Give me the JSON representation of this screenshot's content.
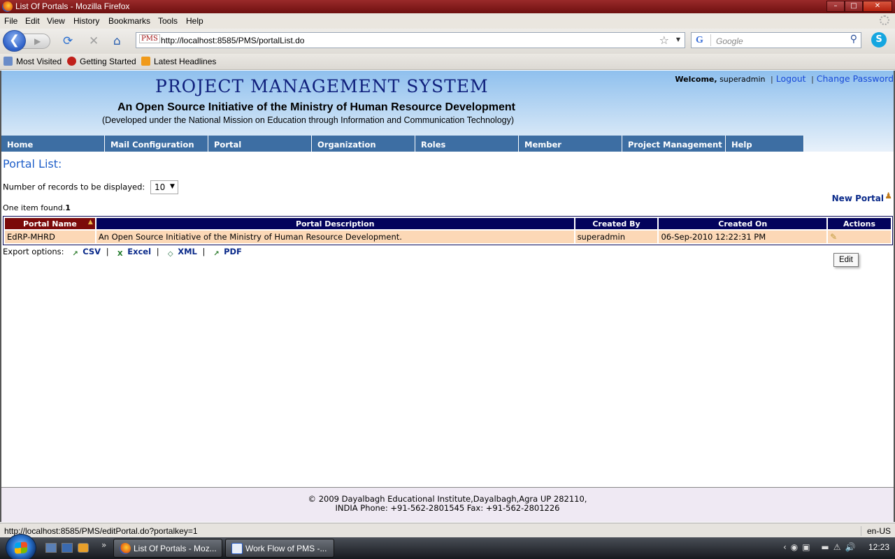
{
  "window": {
    "title": "List Of Portals - Mozilla Firefox",
    "buttons": [
      "–",
      "□",
      "✕"
    ]
  },
  "menubar": [
    "File",
    "Edit",
    "View",
    "History",
    "Bookmarks",
    "Tools",
    "Help"
  ],
  "navbar": {
    "url": "http://localhost:8585/PMS/portalList.do",
    "site_icon": "PMS",
    "search_placeholder": "Google",
    "search_engine_glyph": "G"
  },
  "bookmarks": [
    "Most Visited",
    "Getting Started",
    "Latest Headlines"
  ],
  "header": {
    "title": "PROJECT MANAGEMENT SYSTEM",
    "subtitle": "An Open Source Initiative of the Ministry of Human Resource Development",
    "subtitle2": "(Developed under the National Mission on Education through Information and Communication Technology)",
    "welcome_label": "Welcome,",
    "user": "superadmin",
    "sep": "|",
    "logout": "Logout",
    "change_password": "Change Password"
  },
  "mainnav": [
    "Home",
    "Mail Configuration",
    "Portal",
    "Organization",
    "Roles",
    "Member",
    "Project Management",
    "Help"
  ],
  "content": {
    "list_title": "Portal List:",
    "records_label": "Number of records to be displayed:",
    "records_value": "10",
    "new_portal": "New Portal",
    "found_text": "One item found.",
    "found_page": "1"
  },
  "table": {
    "headers": [
      "Portal Name",
      "Portal Description",
      "Created By",
      "Created On",
      "Actions"
    ],
    "rows": [
      {
        "name": "EdRP-MHRD",
        "description": "An Open Source Initiative of the Ministry of Human Resource Development.",
        "created_by": "superadmin",
        "created_on": "06-Sep-2010 12:22:31 PM"
      }
    ]
  },
  "export": {
    "label": "Export options:",
    "pipe": "|",
    "options": [
      "CSV",
      "Excel",
      "XML",
      "PDF"
    ]
  },
  "tooltip": "Edit",
  "footer": {
    "line1": "© 2009 Dayalbagh Educational Institute,Dayalbagh,Agra UP 282110,",
    "line2": "INDIA Phone: +91-562-2801545 Fax: +91-562-2801226"
  },
  "statusbar": {
    "url": "http://localhost:8585/PMS/editPortal.do?portalkey=1",
    "lang": "en-US"
  },
  "taskbar": {
    "tasks": [
      "List Of Portals - Moz...",
      "Work Flow of PMS -..."
    ],
    "clock": "12:23"
  }
}
